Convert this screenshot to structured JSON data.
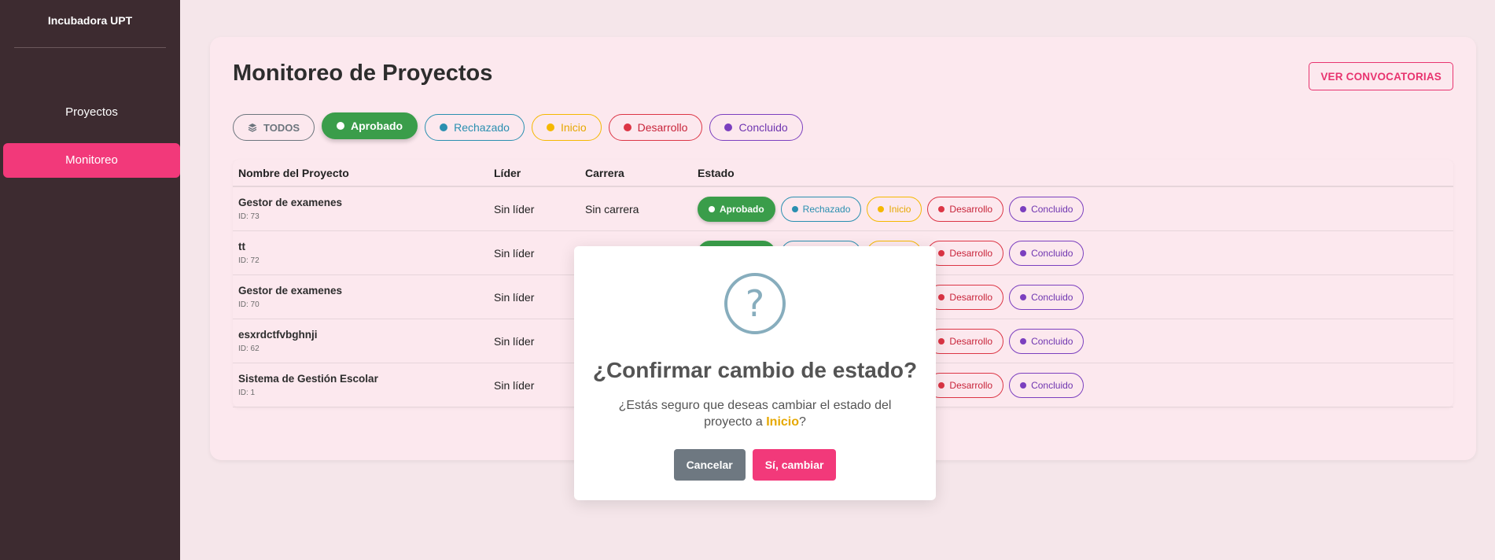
{
  "sidebar": {
    "brand": "Incubadora UPT",
    "items": [
      {
        "label": "Proyectos"
      },
      {
        "label": "Monitoreo"
      }
    ]
  },
  "header": {
    "title": "Monitoreo de Proyectos",
    "convocatorias_button": "VER CONVOCATORIAS"
  },
  "filters": {
    "todos": "TODOS",
    "aprobado": "Aprobado",
    "rechazado": "Rechazado",
    "inicio": "Inicio",
    "desarrollo": "Desarrollo",
    "concluido": "Concluido"
  },
  "table": {
    "columns": [
      "Nombre del Proyecto",
      "Líder",
      "Carrera",
      "Estado"
    ],
    "rows": [
      {
        "name": "Gestor de examenes",
        "id": "ID: 73",
        "lider": "Sin líder",
        "carrera": "Sin carrera"
      },
      {
        "name": "tt",
        "id": "ID: 72",
        "lider": "Sin líder",
        "carrera": ""
      },
      {
        "name": "Gestor de examenes",
        "id": "ID: 70",
        "lider": "Sin líder",
        "carrera": ""
      },
      {
        "name": "esxrdctfvbghnji",
        "id": "ID: 62",
        "lider": "Sin líder",
        "carrera": ""
      },
      {
        "name": "Sistema de Gestión Escolar",
        "id": "ID: 1",
        "lider": "Sin líder",
        "carrera": ""
      }
    ],
    "status_labels": {
      "aprobado": "Aprobado",
      "rechazado": "Rechazado",
      "inicio": "Inicio",
      "desarrollo": "Desarrollo",
      "concluido": "Concluido"
    }
  },
  "modal": {
    "icon": "question-icon",
    "title": "¿Confirmar cambio de estado?",
    "text_before": "¿Estás seguro que deseas cambiar el estado del proyecto a ",
    "highlight": "Inicio",
    "text_after": "?",
    "cancel": "Cancelar",
    "confirm": "Sí, cambiar"
  },
  "colors": {
    "accent": "#f2397a",
    "sidebar_bg": "#3d2b30",
    "aprobado": "#3a9d4a",
    "rechazado": "#2a8fb0",
    "inicio": "#f5b800",
    "desarrollo": "#dc3545",
    "concluido": "#7b3fbf"
  }
}
